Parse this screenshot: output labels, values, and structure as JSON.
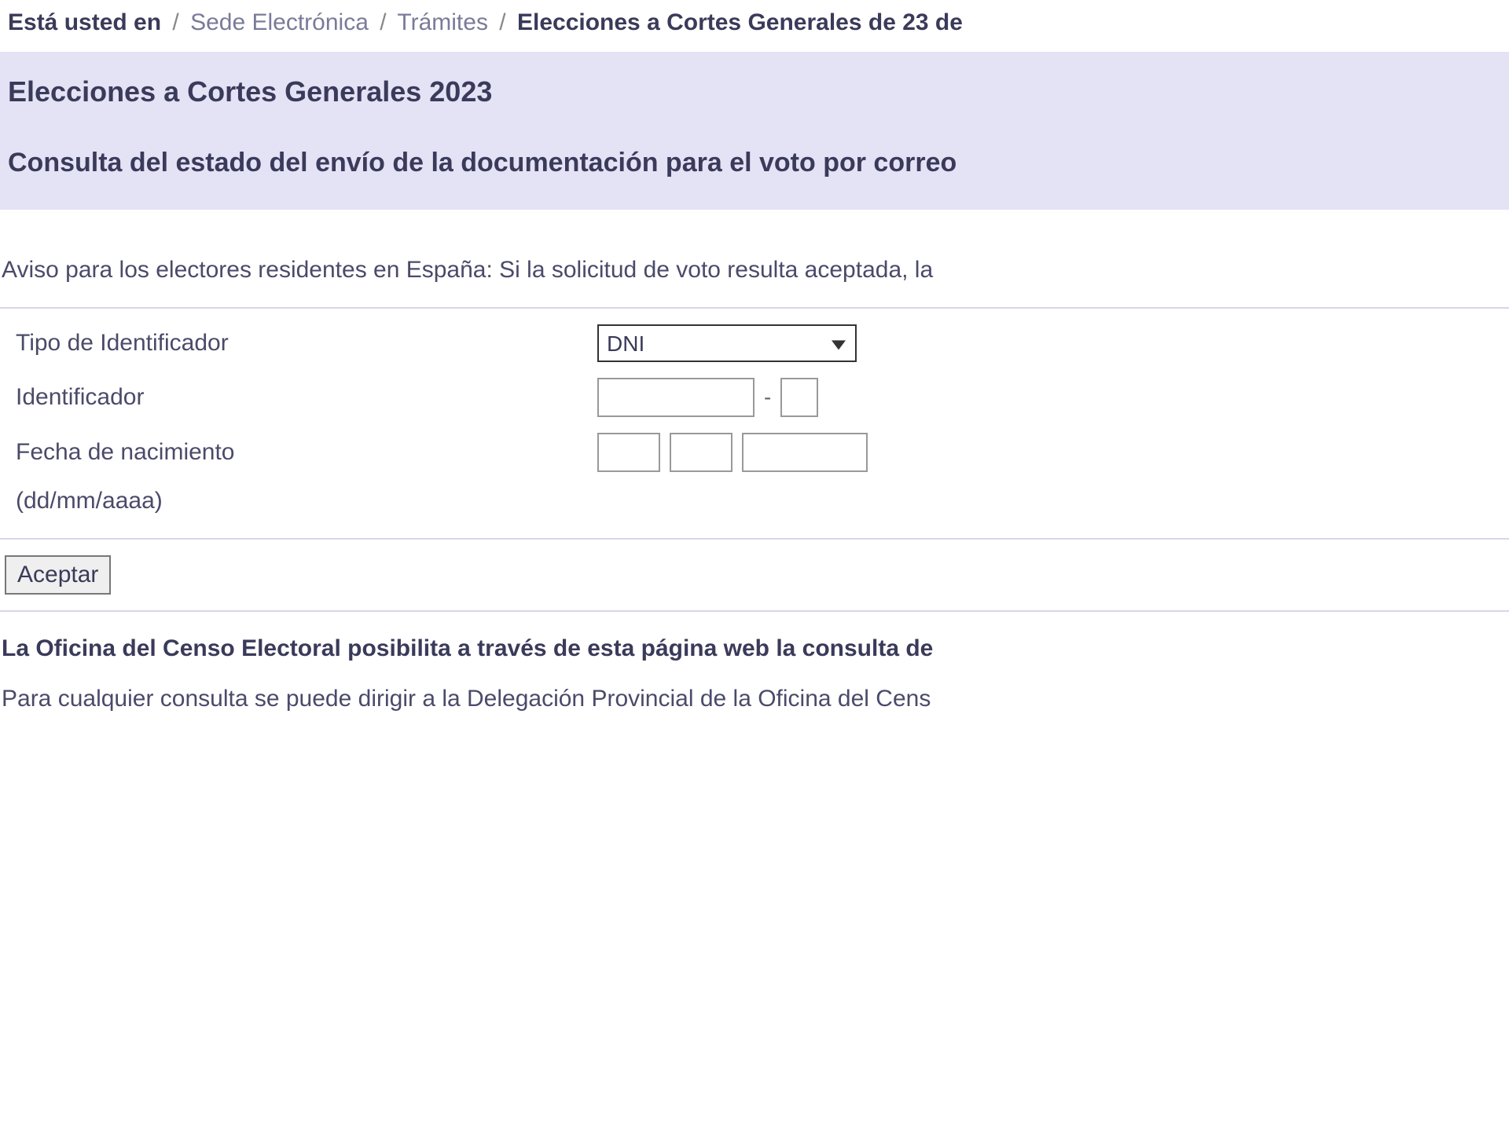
{
  "breadcrumb": {
    "prefix": "Está usted en",
    "sep": "/",
    "items": [
      "Sede Electrónica",
      "Trámites"
    ],
    "current": "Elecciones a Cortes Generales de 23 de"
  },
  "header": {
    "title": "Elecciones a Cortes Generales 2023",
    "subtitle": "Consulta del estado del envío de la documentación para el voto por correo"
  },
  "notice": "Aviso para los electores residentes en España: Si la solicitud de voto resulta aceptada, la",
  "form": {
    "id_type": {
      "label": "Tipo de Identificador",
      "selected": "DNI",
      "options": [
        "DNI"
      ]
    },
    "identifier": {
      "label": "Identificador",
      "main_value": "",
      "letter_value": "",
      "dash": "-"
    },
    "dob": {
      "label": "Fecha de nacimiento",
      "hint": "(dd/mm/aaaa)",
      "day": "",
      "month": "",
      "year": ""
    },
    "submit_label": "Aceptar"
  },
  "info": {
    "strong": "La Oficina del Censo Electoral posibilita a través de esta página web la consulta de",
    "para": "Para cualquier consulta se puede dirigir a la Delegación Provincial de la Oficina del Cens"
  }
}
